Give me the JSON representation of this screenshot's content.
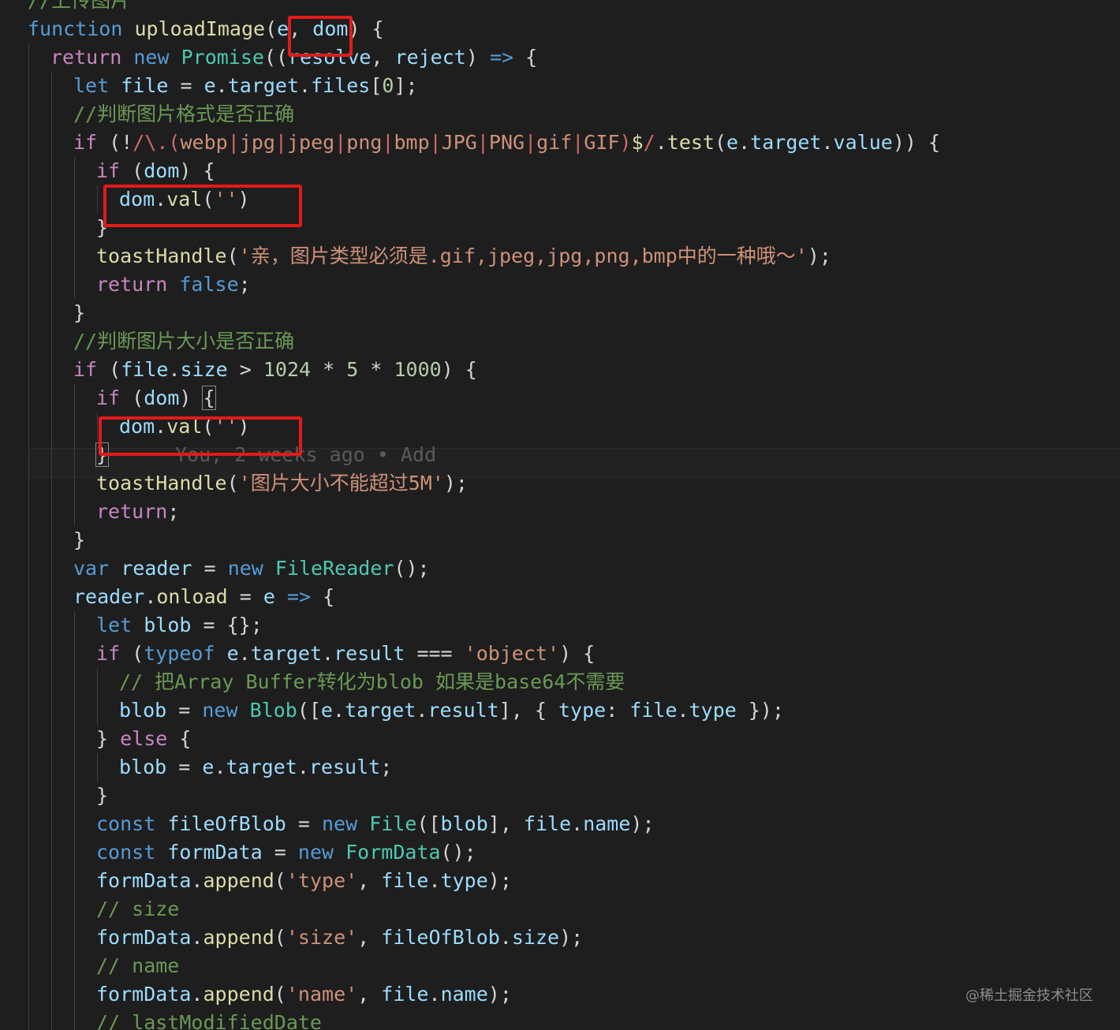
{
  "editor": {
    "current_line_index": 16,
    "colors": {
      "background": "#1e1e1e",
      "comment": "#6a9955",
      "keyword": "#569cd6",
      "control": "#c586c0",
      "function": "#dcdcaa",
      "class": "#4ec9b0",
      "variable": "#9cdcfe",
      "string": "#ce9178",
      "number": "#b5cea8",
      "regex": "#d16969",
      "highlight_box": "#e21a1a"
    },
    "blame": "You, 2 weeks ago • Add",
    "watermark": "@稀土掘金技术社区",
    "lines": [
      {
        "indent": 0,
        "tokens": [
          [
            "cm",
            "//上传图片"
          ]
        ]
      },
      {
        "indent": 0,
        "tokens": [
          [
            "kw",
            "function"
          ],
          [
            "pu",
            " "
          ],
          [
            "fn",
            "uploadImage"
          ],
          [
            "pu",
            "("
          ],
          [
            "vr",
            "e"
          ],
          [
            "pu",
            ", "
          ],
          [
            "vr",
            "dom"
          ],
          [
            "pu",
            ") {"
          ]
        ]
      },
      {
        "indent": 1,
        "tokens": [
          [
            "kc",
            "return"
          ],
          [
            "pu",
            " "
          ],
          [
            "kw",
            "new"
          ],
          [
            "pu",
            " "
          ],
          [
            "cl",
            "Promise"
          ],
          [
            "pu",
            "(("
          ],
          [
            "vr",
            "resolve"
          ],
          [
            "pu",
            ", "
          ],
          [
            "vr",
            "reject"
          ],
          [
            "pu",
            ") "
          ],
          [
            "kw",
            "=>"
          ],
          [
            "pu",
            " {"
          ]
        ]
      },
      {
        "indent": 2,
        "tokens": [
          [
            "kw",
            "let"
          ],
          [
            "pu",
            " "
          ],
          [
            "vr",
            "file"
          ],
          [
            "pu",
            " = "
          ],
          [
            "vr",
            "e"
          ],
          [
            "pu",
            "."
          ],
          [
            "pp",
            "target"
          ],
          [
            "pu",
            "."
          ],
          [
            "pp",
            "files"
          ],
          [
            "pu",
            "["
          ],
          [
            "nm",
            "0"
          ],
          [
            "pu",
            "];"
          ]
        ]
      },
      {
        "indent": 2,
        "tokens": [
          [
            "cm",
            "//判断图片格式是否正确"
          ]
        ]
      },
      {
        "indent": 2,
        "tokens": [
          [
            "kc",
            "if"
          ],
          [
            "pu",
            " (!"
          ],
          [
            "rx",
            "/\\.("
          ],
          [
            "st",
            "webp"
          ],
          [
            "rx",
            "|"
          ],
          [
            "st",
            "jpg"
          ],
          [
            "rx",
            "|"
          ],
          [
            "st",
            "jpeg"
          ],
          [
            "rx",
            "|"
          ],
          [
            "st",
            "png"
          ],
          [
            "rx",
            "|"
          ],
          [
            "st",
            "bmp"
          ],
          [
            "rx",
            "|"
          ],
          [
            "st",
            "JPG"
          ],
          [
            "rx",
            "|"
          ],
          [
            "st",
            "PNG"
          ],
          [
            "rx",
            "|"
          ],
          [
            "st",
            "gif"
          ],
          [
            "rx",
            "|"
          ],
          [
            "st",
            "GIF"
          ],
          [
            "rx",
            ")"
          ],
          [
            "rd",
            "$"
          ],
          [
            "rx",
            "/"
          ],
          [
            "pu",
            "."
          ],
          [
            "fn",
            "test"
          ],
          [
            "pu",
            "("
          ],
          [
            "vr",
            "e"
          ],
          [
            "pu",
            "."
          ],
          [
            "pp",
            "target"
          ],
          [
            "pu",
            "."
          ],
          [
            "pp",
            "value"
          ],
          [
            "pu",
            ")) {"
          ]
        ]
      },
      {
        "indent": 3,
        "tokens": [
          [
            "kc",
            "if"
          ],
          [
            "pu",
            " ("
          ],
          [
            "vr",
            "dom"
          ],
          [
            "pu",
            ") {"
          ]
        ]
      },
      {
        "indent": 4,
        "tokens": [
          [
            "vr",
            "dom"
          ],
          [
            "pu",
            "."
          ],
          [
            "fn",
            "val"
          ],
          [
            "pu",
            "("
          ],
          [
            "st",
            "''"
          ],
          [
            "pu",
            ")"
          ]
        ]
      },
      {
        "indent": 3,
        "tokens": [
          [
            "pu",
            "}"
          ]
        ]
      },
      {
        "indent": 3,
        "tokens": [
          [
            "fn",
            "toastHandle"
          ],
          [
            "pu",
            "("
          ],
          [
            "st",
            "'亲，图片类型必须是.gif,jpeg,jpg,png,bmp中的一种哦～'"
          ],
          [
            "pu",
            ");"
          ]
        ]
      },
      {
        "indent": 3,
        "tokens": [
          [
            "kc",
            "return"
          ],
          [
            "pu",
            " "
          ],
          [
            "kw",
            "false"
          ],
          [
            "pu",
            ";"
          ]
        ]
      },
      {
        "indent": 2,
        "tokens": [
          [
            "pu",
            "}"
          ]
        ]
      },
      {
        "indent": 2,
        "tokens": [
          [
            "cm",
            "//判断图片大小是否正确"
          ]
        ]
      },
      {
        "indent": 2,
        "tokens": [
          [
            "kc",
            "if"
          ],
          [
            "pu",
            " ("
          ],
          [
            "vr",
            "file"
          ],
          [
            "pu",
            "."
          ],
          [
            "pp",
            "size"
          ],
          [
            "pu",
            " > "
          ],
          [
            "nm",
            "1024"
          ],
          [
            "pu",
            " * "
          ],
          [
            "nm",
            "5"
          ],
          [
            "pu",
            " * "
          ],
          [
            "nm",
            "1000"
          ],
          [
            "pu",
            ") {"
          ]
        ]
      },
      {
        "indent": 3,
        "tokens": [
          [
            "kc",
            "if"
          ],
          [
            "pu",
            " ("
          ],
          [
            "vr",
            "dom"
          ],
          [
            "pu",
            ") "
          ],
          [
            "pu",
            "{"
          ]
        ]
      },
      {
        "indent": 4,
        "tokens": [
          [
            "vr",
            "dom"
          ],
          [
            "pu",
            "."
          ],
          [
            "fn",
            "val"
          ],
          [
            "pu",
            "("
          ],
          [
            "st",
            "''"
          ],
          [
            "pu",
            ")"
          ]
        ]
      },
      {
        "indent": 3,
        "tokens": [
          [
            "pu",
            "}"
          ]
        ]
      },
      {
        "indent": 3,
        "tokens": [
          [
            "fn",
            "toastHandle"
          ],
          [
            "pu",
            "("
          ],
          [
            "st",
            "'图片大小不能超过5M'"
          ],
          [
            "pu",
            ");"
          ]
        ]
      },
      {
        "indent": 3,
        "tokens": [
          [
            "kc",
            "return"
          ],
          [
            "pu",
            ";"
          ]
        ]
      },
      {
        "indent": 2,
        "tokens": [
          [
            "pu",
            "}"
          ]
        ]
      },
      {
        "indent": 2,
        "tokens": [
          [
            "kw",
            "var"
          ],
          [
            "pu",
            " "
          ],
          [
            "vr",
            "reader"
          ],
          [
            "pu",
            " = "
          ],
          [
            "kw",
            "new"
          ],
          [
            "pu",
            " "
          ],
          [
            "cl",
            "FileReader"
          ],
          [
            "pu",
            "();"
          ]
        ]
      },
      {
        "indent": 2,
        "tokens": [
          [
            "vr",
            "reader"
          ],
          [
            "pu",
            "."
          ],
          [
            "fn",
            "onload"
          ],
          [
            "pu",
            " = "
          ],
          [
            "vr",
            "e"
          ],
          [
            "pu",
            " "
          ],
          [
            "kw",
            "=>"
          ],
          [
            "pu",
            " {"
          ]
        ]
      },
      {
        "indent": 3,
        "tokens": [
          [
            "kw",
            "let"
          ],
          [
            "pu",
            " "
          ],
          [
            "vr",
            "blob"
          ],
          [
            "pu",
            " = {};"
          ]
        ]
      },
      {
        "indent": 3,
        "tokens": [
          [
            "kc",
            "if"
          ],
          [
            "pu",
            " ("
          ],
          [
            "kw",
            "typeof"
          ],
          [
            "pu",
            " "
          ],
          [
            "vr",
            "e"
          ],
          [
            "pu",
            "."
          ],
          [
            "pp",
            "target"
          ],
          [
            "pu",
            "."
          ],
          [
            "pp",
            "result"
          ],
          [
            "pu",
            " === "
          ],
          [
            "st",
            "'object'"
          ],
          [
            "pu",
            ") {"
          ]
        ]
      },
      {
        "indent": 4,
        "tokens": [
          [
            "cm",
            "// 把Array Buffer转化为blob 如果是base64不需要"
          ]
        ]
      },
      {
        "indent": 4,
        "tokens": [
          [
            "vr",
            "blob"
          ],
          [
            "pu",
            " = "
          ],
          [
            "kw",
            "new"
          ],
          [
            "pu",
            " "
          ],
          [
            "cl",
            "Blob"
          ],
          [
            "pu",
            "(["
          ],
          [
            "vr",
            "e"
          ],
          [
            "pu",
            "."
          ],
          [
            "pp",
            "target"
          ],
          [
            "pu",
            "."
          ],
          [
            "pp",
            "result"
          ],
          [
            "pu",
            "], { "
          ],
          [
            "pp",
            "type"
          ],
          [
            "pu",
            ": "
          ],
          [
            "vr",
            "file"
          ],
          [
            "pu",
            "."
          ],
          [
            "pp",
            "type"
          ],
          [
            "pu",
            " });"
          ]
        ]
      },
      {
        "indent": 3,
        "tokens": [
          [
            "pu",
            "} "
          ],
          [
            "kc",
            "else"
          ],
          [
            "pu",
            " {"
          ]
        ]
      },
      {
        "indent": 4,
        "tokens": [
          [
            "vr",
            "blob"
          ],
          [
            "pu",
            " = "
          ],
          [
            "vr",
            "e"
          ],
          [
            "pu",
            "."
          ],
          [
            "pp",
            "target"
          ],
          [
            "pu",
            "."
          ],
          [
            "pp",
            "result"
          ],
          [
            "pu",
            ";"
          ]
        ]
      },
      {
        "indent": 3,
        "tokens": [
          [
            "pu",
            "}"
          ]
        ]
      },
      {
        "indent": 3,
        "tokens": [
          [
            "kw",
            "const"
          ],
          [
            "pu",
            " "
          ],
          [
            "vr",
            "fileOfBlob"
          ],
          [
            "pu",
            " = "
          ],
          [
            "kw",
            "new"
          ],
          [
            "pu",
            " "
          ],
          [
            "cl",
            "File"
          ],
          [
            "pu",
            "(["
          ],
          [
            "vr",
            "blob"
          ],
          [
            "pu",
            "], "
          ],
          [
            "vr",
            "file"
          ],
          [
            "pu",
            "."
          ],
          [
            "pp",
            "name"
          ],
          [
            "pu",
            ");"
          ]
        ]
      },
      {
        "indent": 3,
        "tokens": [
          [
            "kw",
            "const"
          ],
          [
            "pu",
            " "
          ],
          [
            "vr",
            "formData"
          ],
          [
            "pu",
            " = "
          ],
          [
            "kw",
            "new"
          ],
          [
            "pu",
            " "
          ],
          [
            "cl",
            "FormData"
          ],
          [
            "pu",
            "();"
          ]
        ]
      },
      {
        "indent": 3,
        "tokens": [
          [
            "vr",
            "formData"
          ],
          [
            "pu",
            "."
          ],
          [
            "fn",
            "append"
          ],
          [
            "pu",
            "("
          ],
          [
            "st",
            "'type'"
          ],
          [
            "pu",
            ", "
          ],
          [
            "vr",
            "file"
          ],
          [
            "pu",
            "."
          ],
          [
            "pp",
            "type"
          ],
          [
            "pu",
            ");"
          ]
        ]
      },
      {
        "indent": 3,
        "tokens": [
          [
            "cm",
            "// size"
          ]
        ]
      },
      {
        "indent": 3,
        "tokens": [
          [
            "vr",
            "formData"
          ],
          [
            "pu",
            "."
          ],
          [
            "fn",
            "append"
          ],
          [
            "pu",
            "("
          ],
          [
            "st",
            "'size'"
          ],
          [
            "pu",
            ", "
          ],
          [
            "vr",
            "fileOfBlob"
          ],
          [
            "pu",
            "."
          ],
          [
            "pp",
            "size"
          ],
          [
            "pu",
            ");"
          ]
        ]
      },
      {
        "indent": 3,
        "tokens": [
          [
            "cm",
            "// name"
          ]
        ]
      },
      {
        "indent": 3,
        "tokens": [
          [
            "vr",
            "formData"
          ],
          [
            "pu",
            "."
          ],
          [
            "fn",
            "append"
          ],
          [
            "pu",
            "("
          ],
          [
            "st",
            "'name'"
          ],
          [
            "pu",
            ", "
          ],
          [
            "vr",
            "file"
          ],
          [
            "pu",
            "."
          ],
          [
            "pp",
            "name"
          ],
          [
            "pu",
            ");"
          ]
        ]
      },
      {
        "indent": 3,
        "tokens": [
          [
            "cm",
            "// lastModifiedDate"
          ]
        ]
      }
    ]
  }
}
